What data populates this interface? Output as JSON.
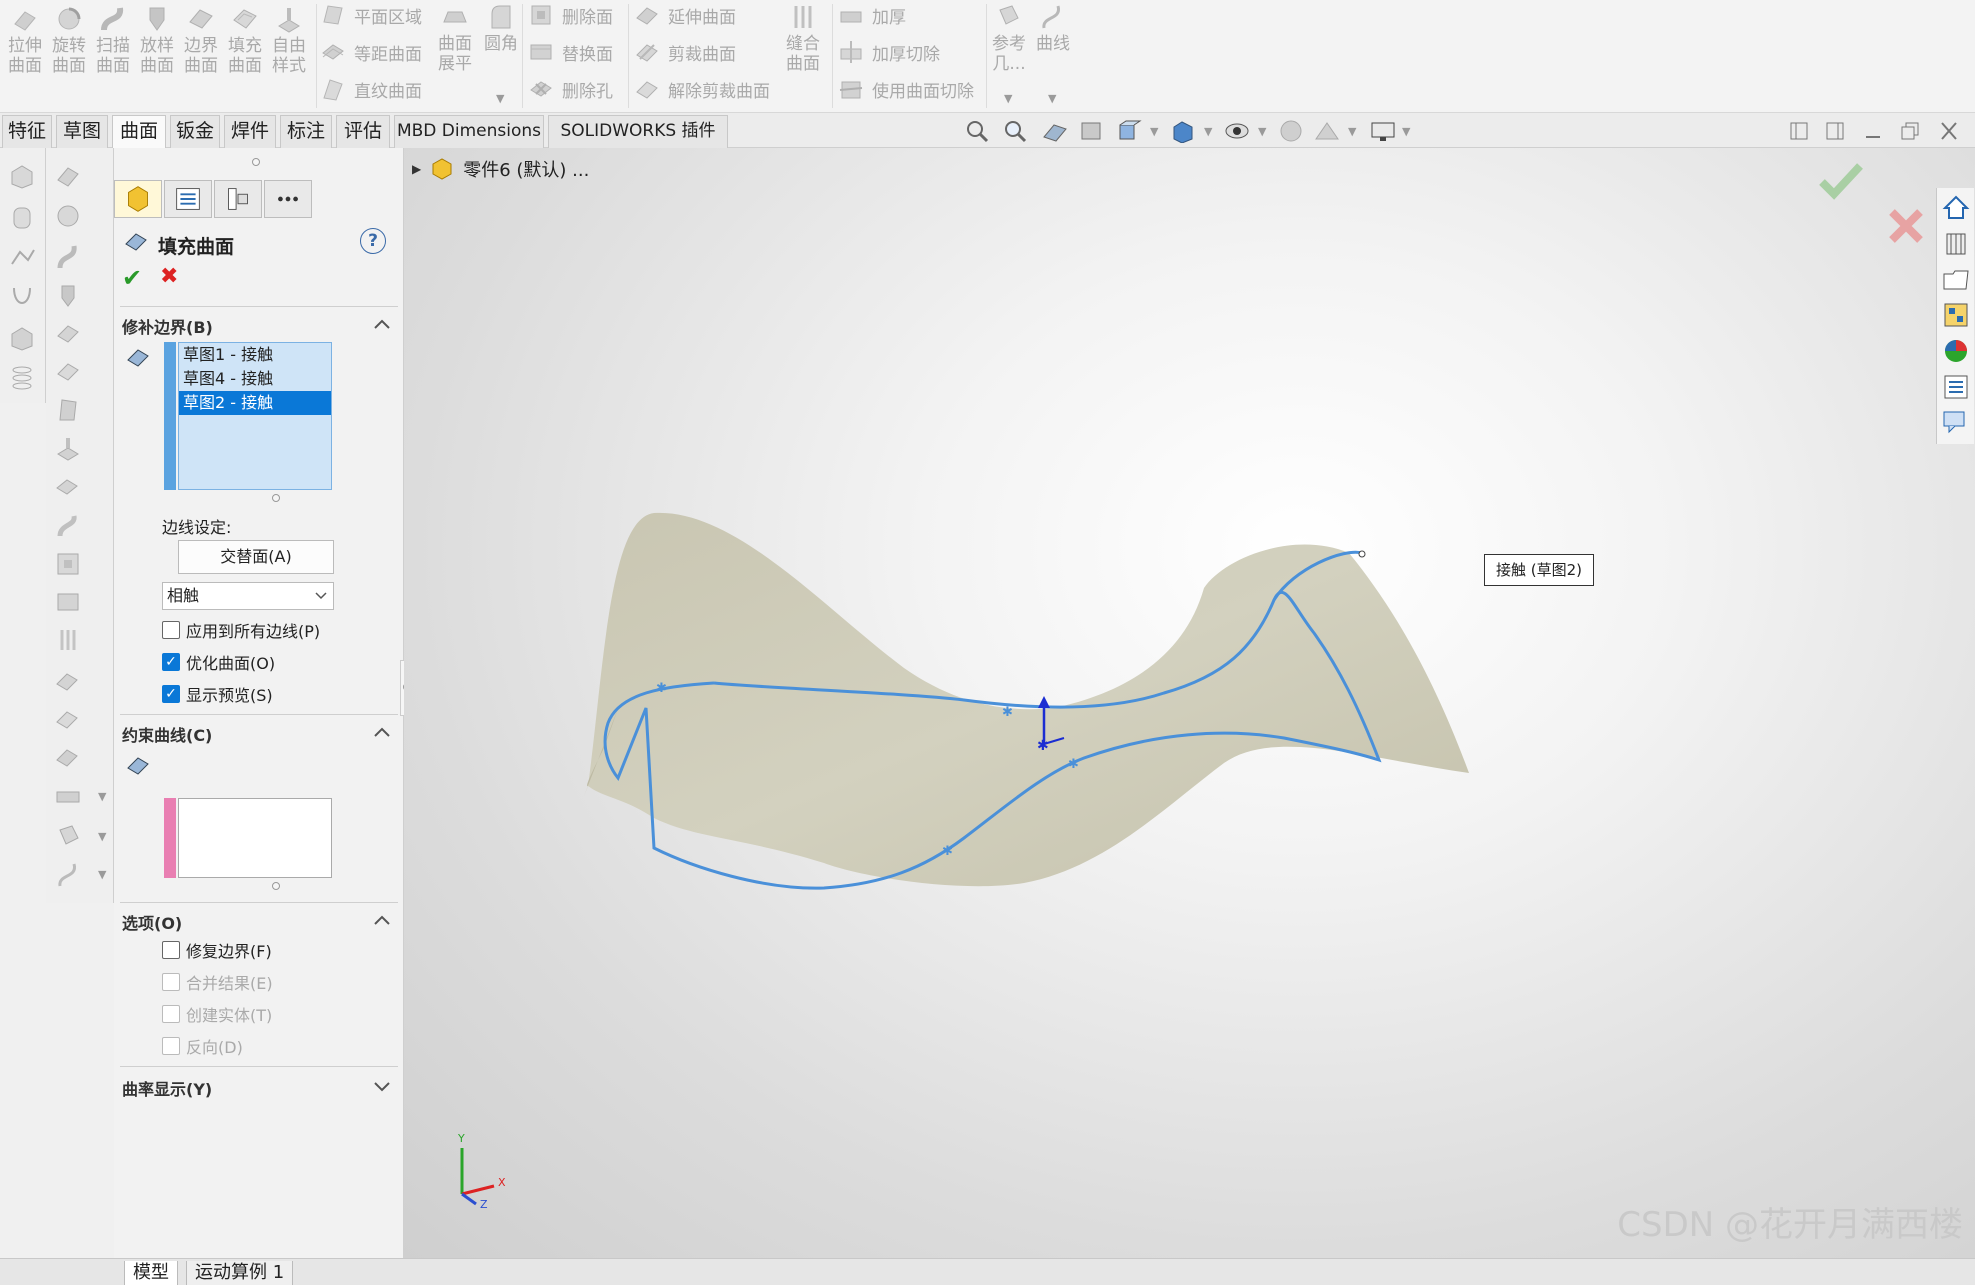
{
  "ribbon": {
    "big_buttons": [
      {
        "line1": "拉伸",
        "line2": "曲面",
        "icon": "extrude-surface-icon"
      },
      {
        "line1": "旋转",
        "line2": "曲面",
        "icon": "revolve-surface-icon"
      },
      {
        "line1": "扫描",
        "line2": "曲面",
        "icon": "sweep-surface-icon"
      },
      {
        "line1": "放样",
        "line2": "曲面",
        "icon": "loft-surface-icon"
      },
      {
        "line1": "边界",
        "line2": "曲面",
        "icon": "boundary-surface-icon"
      },
      {
        "line1": "填充",
        "line2": "曲面",
        "icon": "fill-surface-icon"
      },
      {
        "line1": "自由",
        "line2": "样式",
        "icon": "freeform-icon"
      }
    ],
    "col_a": [
      "平面区域",
      "等距曲面",
      "直纹曲面"
    ],
    "flatten": {
      "line1": "曲面",
      "line2": "展平"
    },
    "fillet": {
      "line1": "圆角"
    },
    "col_b": [
      "删除面",
      "替换面",
      "删除孔"
    ],
    "col_c": [
      "延伸曲面",
      "剪裁曲面",
      "解除剪裁曲面"
    ],
    "knit": {
      "line1": "缝合",
      "line2": "曲面"
    },
    "col_d": [
      "加厚",
      "加厚切除",
      "使用曲面切除"
    ],
    "reference": {
      "line1": "参考",
      "line2": "几..."
    },
    "curves": {
      "line1": "曲线"
    }
  },
  "tabs": [
    "特征",
    "草图",
    "曲面",
    "钣金",
    "焊件",
    "标注",
    "评估",
    "MBD Dimensions",
    "SOLIDWORKS 插件"
  ],
  "active_tab": "曲面",
  "tree": {
    "part_name": "零件6 (默认) ..."
  },
  "pm": {
    "title": "填充曲面",
    "help": "?",
    "ok": "✔",
    "cancel": "✖",
    "section_boundary": "修补边界(B)",
    "boundary_items": [
      "草图1 - 接触",
      "草图4 - 接触",
      "草图2 - 接触"
    ],
    "edge_settings_label": "边线设定:",
    "alternate_face_button": "交替面(A)",
    "condition_select": "相触",
    "cb_apply_all": "应用到所有边线(P)",
    "cb_optimize": "优化曲面(O)",
    "cb_preview": "显示预览(S)",
    "section_constraint": "约束曲线(C)",
    "section_options": "选项(O)",
    "cb_fix_boundary": "修复边界(F)",
    "cb_merge": "合并结果(E)",
    "cb_solid": "创建实体(T)",
    "cb_reverse": "反向(D)",
    "section_curvature": "曲率显示(Y)"
  },
  "callout": {
    "label": "接触 (草图2)"
  },
  "triad": {
    "x": "X",
    "y": "Y",
    "z": "Z"
  },
  "bottom_tabs": [
    "模型",
    "运动算例 1"
  ],
  "watermark": "CSDN @花开月满西楼"
}
